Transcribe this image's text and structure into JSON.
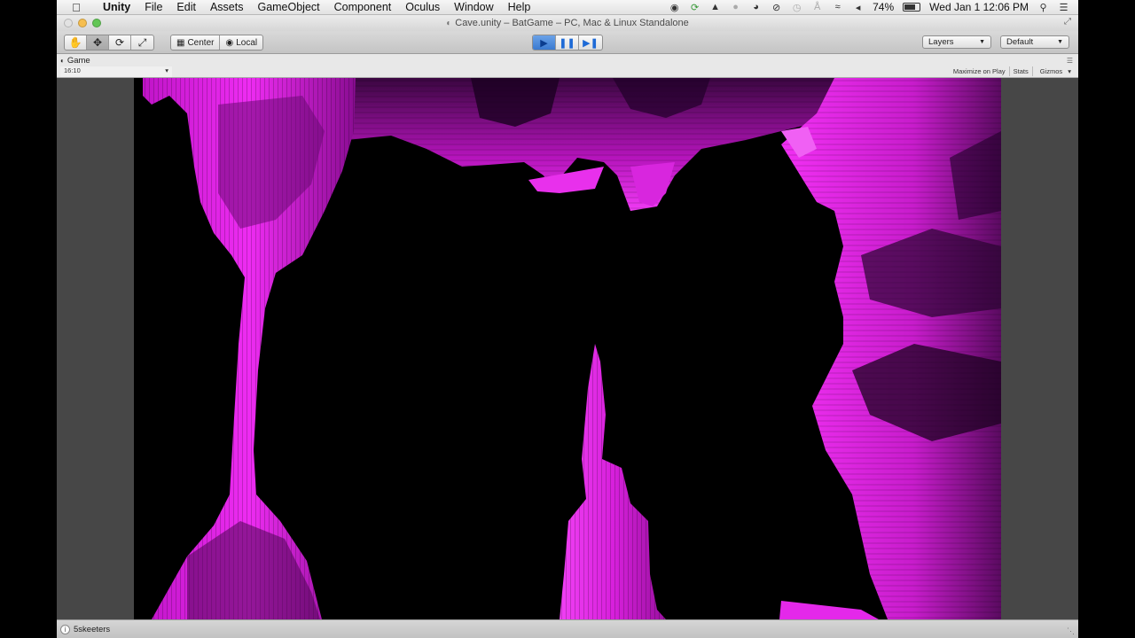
{
  "menubar": {
    "app": "Unity",
    "items": [
      "File",
      "Edit",
      "Assets",
      "GameObject",
      "Component",
      "Oculus",
      "Window",
      "Help"
    ],
    "battery_percent": "74%",
    "battery_level": 0.74,
    "datetime": "Wed Jan 1  12:06 PM"
  },
  "window": {
    "title": "Cave.unity – BatGame – PC, Mac & Linux Standalone"
  },
  "toolbar": {
    "pivot_center": "Center",
    "pivot_local": "Local",
    "layers": "Layers",
    "layout": "Default"
  },
  "game": {
    "tab_label": "Game",
    "aspect": "16:10",
    "maximize_on_play": "Maximize on Play",
    "stats": "Stats",
    "gizmos": "Gizmos"
  },
  "status": {
    "message": "5skeeters"
  },
  "colors": {
    "cave": "#e020e8",
    "cave_dark": "#7a1080",
    "play_accent": "#3a7ad0"
  }
}
